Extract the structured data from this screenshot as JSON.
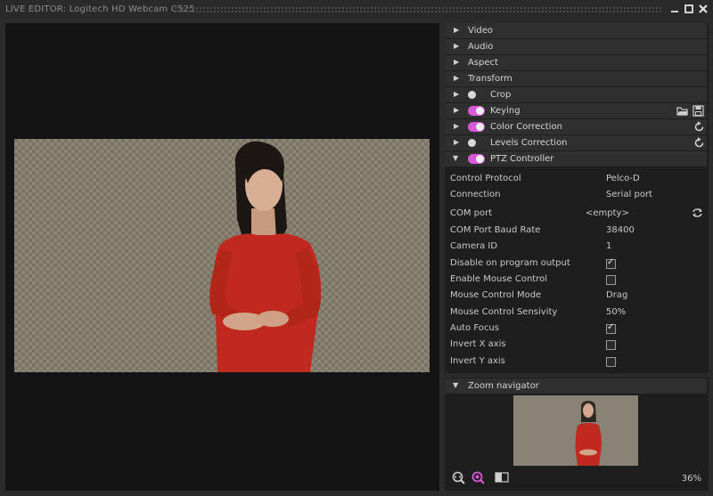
{
  "window": {
    "title": "LIVE EDITOR: Logitech HD Webcam C525",
    "minimize_icon": "minimize-icon",
    "maximize_icon": "maximize-icon",
    "close_icon": "close-icon"
  },
  "sections": [
    {
      "label": "Video",
      "expanded": false,
      "toggle": null
    },
    {
      "label": "Audio",
      "expanded": false,
      "toggle": null
    },
    {
      "label": "Aspect",
      "expanded": false,
      "toggle": null
    },
    {
      "label": "Transform",
      "expanded": false,
      "toggle": null
    },
    {
      "label": "Crop",
      "expanded": false,
      "toggle": "off"
    },
    {
      "label": "Keying",
      "expanded": false,
      "toggle": "on"
    },
    {
      "label": "Color Correction",
      "expanded": false,
      "toggle": "on"
    },
    {
      "label": "Levels Correction",
      "expanded": false,
      "toggle": "off"
    },
    {
      "label": "PTZ Controller",
      "expanded": true,
      "toggle": "on"
    }
  ],
  "ptz": {
    "control_protocol": {
      "label": "Control Protocol",
      "value": "Pelco-D"
    },
    "connection": {
      "label": "Connection",
      "value": "Serial port"
    },
    "com_port": {
      "label": "COM port",
      "value": "<empty>"
    },
    "baud_rate": {
      "label": "COM Port Baud Rate",
      "value": "38400"
    },
    "camera_id": {
      "label": "Camera ID",
      "value": "1"
    },
    "disable_on_output": {
      "label": "Disable on program output",
      "checked": true
    },
    "enable_mouse": {
      "label": "Enable Mouse Control",
      "checked": false
    },
    "mouse_mode": {
      "label": "Mouse Control Mode",
      "value": "Drag"
    },
    "mouse_sensivity": {
      "label": "Mouse Control Sensivity",
      "value": "50%"
    },
    "auto_focus": {
      "label": "Auto Focus",
      "checked": true
    },
    "invert_x": {
      "label": "Invert X axis",
      "checked": false
    },
    "invert_y": {
      "label": "Invert Y axis",
      "checked": false
    }
  },
  "zoom": {
    "title": "Zoom navigator",
    "percent": "36%"
  },
  "colors": {
    "toggle_on": "#d65ad6",
    "toggle_off": "#7a7a7a",
    "dress_red": "#c0291f",
    "panel_bg": "#1e1e1e",
    "header_bg": "#2f2f2f"
  }
}
